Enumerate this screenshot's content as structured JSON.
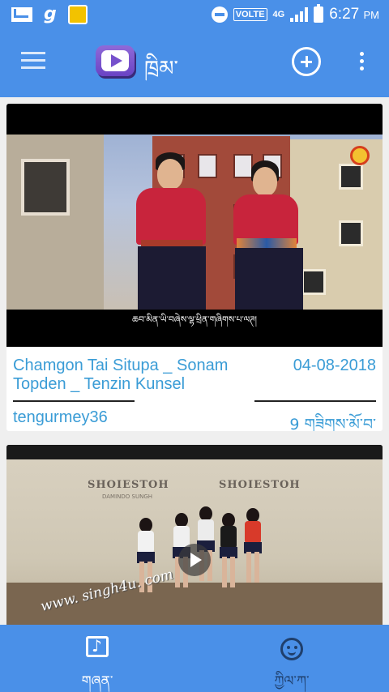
{
  "status_bar": {
    "icons": [
      "gmail-icon",
      "g-app-icon",
      "cleaner-icon",
      "do-not-disturb-icon",
      "volte-icon",
      "4g-icon",
      "signal-icon",
      "battery-icon"
    ],
    "g_letter": "g",
    "volte": "VOLTE",
    "network": "4G",
    "time": "6:27",
    "ampm": "PM"
  },
  "toolbar": {
    "title": "ཁྲིམ་",
    "menu_icon": "hamburger-menu-icon",
    "add_icon": "add-circle-icon",
    "more_icon": "more-vertical-icon",
    "logo_icon": "play-logo-icon"
  },
  "videos": [
    {
      "title": "Chamgon Tai Situpa _ Sonam Topden _ Tenzin Kunsel",
      "date": "04-08-2018",
      "channel": "tengurmey36",
      "views": "9 གཟིགས་མོ་བ་",
      "subtitle": "ཆབ་མིན་ཡི་བཞེས་ལྷ་ཕྲིན་གཞིགས་པ་ལཊ།"
    },
    {
      "brand_left": "SHOIESTOH",
      "brand_right": "SHOIESTOH",
      "brand_sub": "DAMINDO SUNGH",
      "watermark": "www. singh4u. com"
    }
  ],
  "bottom_nav": {
    "items": [
      {
        "label": "གཞན་",
        "icon": "music-note-icon",
        "active": true
      },
      {
        "label": "ཀྱིལ་ཀ་",
        "icon": "smiley-face-icon",
        "active": false
      }
    ]
  },
  "colors": {
    "primary": "#4a90e8",
    "link": "#3a9cd6",
    "inactive_nav": "#1f3f6c"
  }
}
